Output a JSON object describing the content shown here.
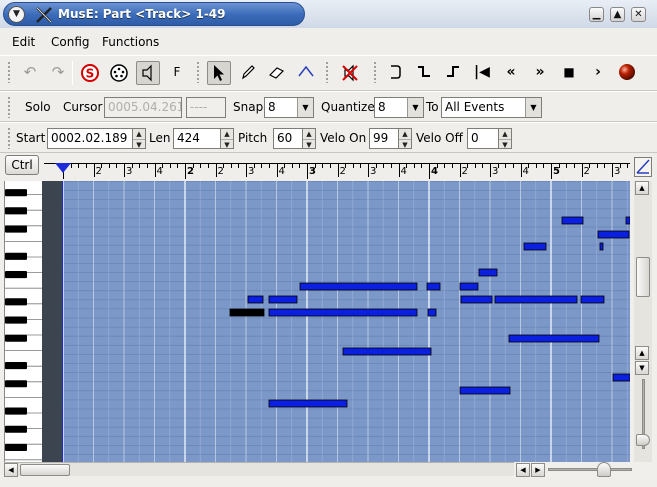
{
  "window": {
    "title": "MusE: Part <Track> 1-49"
  },
  "menubar": {
    "items": [
      "Edit",
      "Config",
      "Functions"
    ]
  },
  "toolbar1": {
    "undo_icon": "undo-icon",
    "redo_icon": "redo-icon",
    "solo_icon": "solo-s-icon",
    "steprec_icon": "midi-din-icon",
    "speaker_icon": "speaker-icon",
    "follow_label": "F",
    "tools": [
      "pointer-icon",
      "pencil-icon",
      "eraser-icon",
      "line-draw-icon"
    ],
    "transport": [
      "rewind-start-icon",
      "loop-icon",
      "punch-in-icon",
      "punch-out-icon",
      "to-start-icon",
      "rewind-icon",
      "fast-forward-icon",
      "stop-icon",
      "play-icon",
      "record-icon"
    ]
  },
  "toolbar2": {
    "solo_label": "Solo",
    "cursor_label": "Cursor",
    "cursor_value": "0005.04.261",
    "cursor_value2": "----",
    "snap_label": "Snap",
    "snap_value": "8",
    "quantize_label": "Quantize",
    "quantize_value": "8",
    "to_label": "To",
    "to_value": "All Events"
  },
  "toolbar3": {
    "start_label": "Start",
    "start_value": "0002.02.189",
    "len_label": "Len",
    "len_value": "424",
    "pitch_label": "Pitch",
    "pitch_value": "60",
    "velo_on_label": "Velo On",
    "velo_on_value": "99",
    "velo_off_label": "Velo Off",
    "velo_off_value": "0"
  },
  "editor": {
    "ctrl_label": "Ctrl",
    "ruler_labels": [
      {
        "text": "2",
        "bar": false
      },
      {
        "text": "3",
        "bar": false
      },
      {
        "text": "4",
        "bar": false
      },
      {
        "text": "2",
        "bar": true
      },
      {
        "text": "2",
        "bar": false
      },
      {
        "text": "3",
        "bar": false
      },
      {
        "text": "4",
        "bar": false
      },
      {
        "text": "3",
        "bar": true
      },
      {
        "text": "2",
        "bar": false
      },
      {
        "text": "3",
        "bar": false
      },
      {
        "text": "4",
        "bar": false
      },
      {
        "text": "4",
        "bar": true
      },
      {
        "text": "2",
        "bar": false
      },
      {
        "text": "3",
        "bar": false
      },
      {
        "text": "4",
        "bar": false
      },
      {
        "text": "5",
        "bar": true
      },
      {
        "text": "2",
        "bar": false
      },
      {
        "text": "3",
        "bar": false
      }
    ],
    "colors": {
      "note": "#0a1fe0",
      "note_selected": "#000000",
      "grid_bg": "#7b98c8"
    }
  }
}
